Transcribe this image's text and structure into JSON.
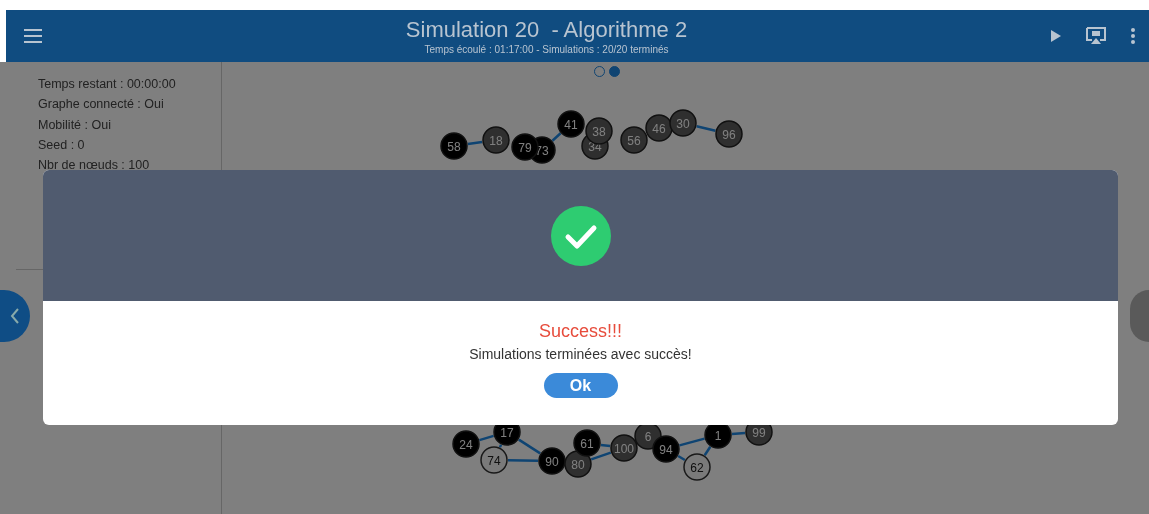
{
  "header": {
    "title": "Simulation 20  - Algorithme 2",
    "subtitle": "Temps écoulé : 01:17:00 - Simulations : 20/20 terminés"
  },
  "sidebar": {
    "lines": [
      "Temps restant : 00:00:00",
      "Graphe connecté : Oui",
      "Mobilité : Oui",
      "Seed : 0",
      "Nbr de nœuds : 100"
    ]
  },
  "pager": [
    {
      "selected": false
    },
    {
      "selected": true
    }
  ],
  "graph": {
    "nodes": [
      {
        "label": "58",
        "kind": "black"
      },
      {
        "label": "18",
        "kind": "grey"
      },
      {
        "label": "79",
        "kind": "black"
      },
      {
        "label": "73",
        "kind": "black"
      },
      {
        "label": "41",
        "kind": "black"
      },
      {
        "label": "34",
        "kind": "grey"
      },
      {
        "label": "38",
        "kind": "grey"
      },
      {
        "label": "56",
        "kind": "grey"
      },
      {
        "label": "46",
        "kind": "grey"
      },
      {
        "label": "30",
        "kind": "grey"
      },
      {
        "label": "96",
        "kind": "grey"
      },
      {
        "label": "24",
        "kind": "black"
      },
      {
        "label": "74",
        "kind": "white"
      },
      {
        "label": "17",
        "kind": "black"
      },
      {
        "label": "90",
        "kind": "black"
      },
      {
        "label": "80",
        "kind": "grey"
      },
      {
        "label": "61",
        "kind": "black"
      },
      {
        "label": "100",
        "kind": "grey"
      },
      {
        "label": "6",
        "kind": "grey"
      },
      {
        "label": "94",
        "kind": "black"
      },
      {
        "label": "62",
        "kind": "white"
      },
      {
        "label": "1",
        "kind": "black"
      },
      {
        "label": "99",
        "kind": "grey"
      }
    ]
  },
  "dialog": {
    "title": "Success!!!",
    "message": "Simulations terminées avec succès!",
    "button": "Ok"
  }
}
